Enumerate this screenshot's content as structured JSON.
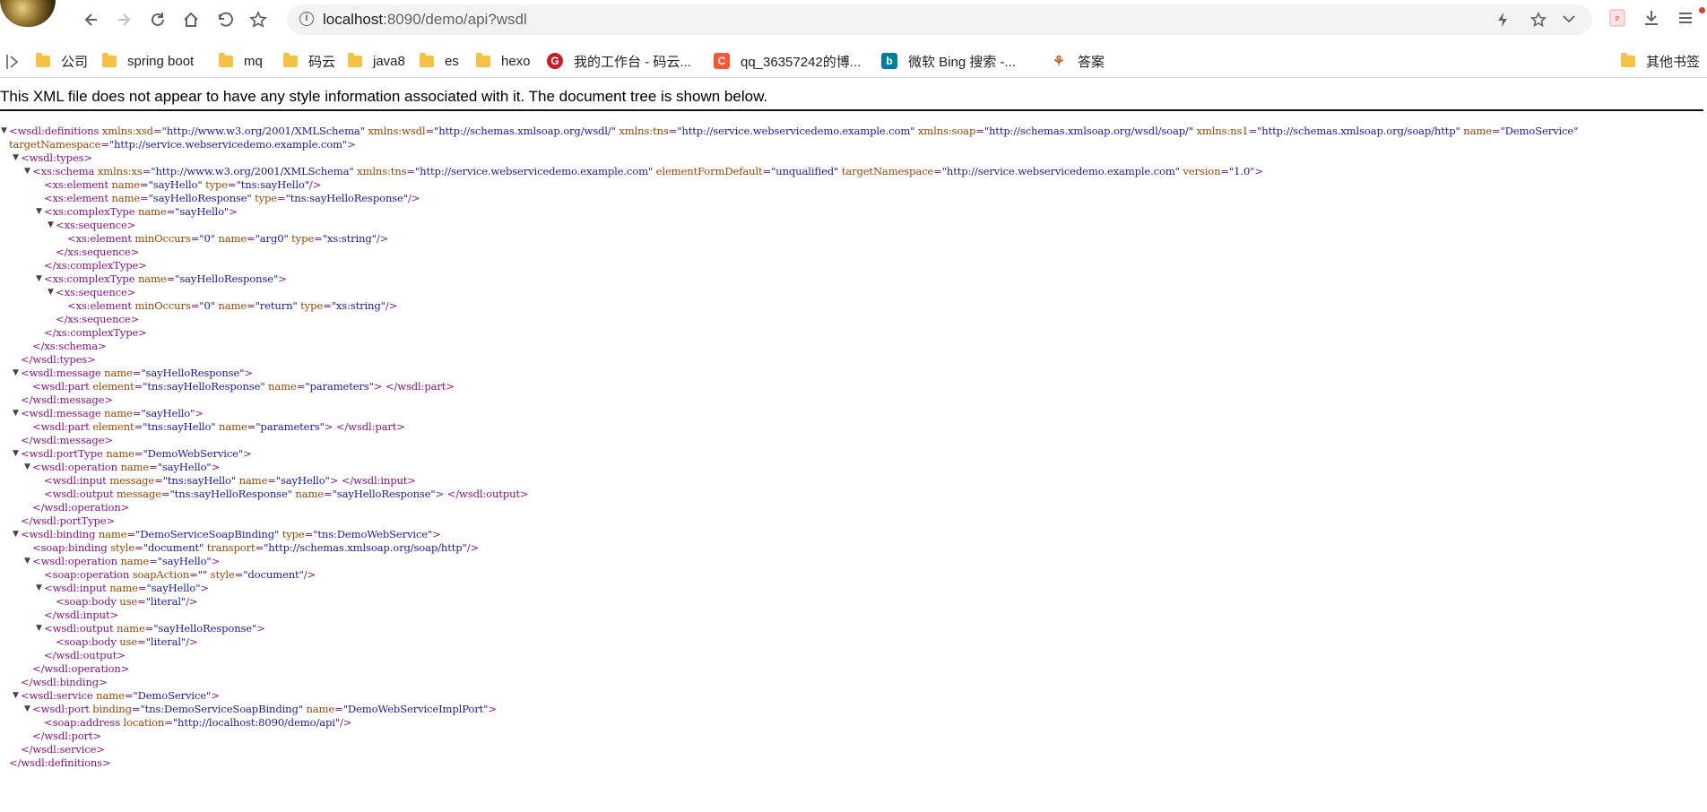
{
  "toolbar": {
    "url_host": "localhost",
    "url_path": ":8090/demo/api?wsdl",
    "icons": [
      "back-icon",
      "forward-icon",
      "reload-icon",
      "home-icon",
      "undo-icon",
      "star-icon",
      "info-icon",
      "lightning-icon",
      "bookmark-star-icon",
      "chevron-down-icon",
      "pdf-icon",
      "download-icon",
      "menu-icon"
    ]
  },
  "bookmarks": [
    {
      "label": "公司",
      "icon": "folder"
    },
    {
      "label": "spring boot",
      "icon": "folder"
    },
    {
      "label": "mq",
      "icon": "folder"
    },
    {
      "label": "码云",
      "icon": "folder"
    },
    {
      "label": "java8",
      "icon": "folder"
    },
    {
      "label": "es",
      "icon": "folder"
    },
    {
      "label": "hexo",
      "icon": "folder"
    },
    {
      "label": "我的工作台 - 码云...",
      "icon": "gitee",
      "color": "#c71d23"
    },
    {
      "label": "qq_36357242的博...",
      "icon": "csdn",
      "color": "#fc5531"
    },
    {
      "label": "微软 Bing 搜索 -...",
      "icon": "bing",
      "color": "#00809d"
    },
    {
      "label": "答案",
      "icon": "deer"
    },
    {
      "label": "其他书签",
      "icon": "folder"
    }
  ],
  "notice": "This XML file does not appear to have any style information associated with it. The document tree is shown below.",
  "colors": {
    "tag": "#881280",
    "attr_name": "#994500",
    "attr_value": "#1a1aa6"
  },
  "xml_lines": [
    {
      "d": 0,
      "t": 1,
      "p": [
        [
          "<wsdl:definitions",
          0
        ],
        [
          " xmlns:xsd",
          1
        ],
        [
          "=",
          0
        ],
        [
          "\"http://www.w3.org/2001/XMLSchema\"",
          2
        ],
        [
          " xmlns:wsdl",
          1
        ],
        [
          "=",
          0
        ],
        [
          "\"http://schemas.xmlsoap.org/wsdl/\"",
          2
        ],
        [
          " xmlns:tns",
          1
        ],
        [
          "=",
          0
        ],
        [
          "\"http://service.webservicedemo.example.com\"",
          2
        ],
        [
          " xmlns:soap",
          1
        ],
        [
          "=",
          0
        ],
        [
          "\"http://schemas.xmlsoap.org/wsdl/soap/\"",
          2
        ],
        [
          " xmlns:ns1",
          1
        ],
        [
          "=",
          0
        ],
        [
          "\"http://schemas.xmlsoap.org/soap/http\"",
          2
        ],
        [
          " name",
          1
        ],
        [
          "=",
          0
        ],
        [
          "\"DemoService\"",
          2
        ]
      ]
    },
    {
      "d": 0,
      "t": 0,
      "p": [
        [
          "targetNamespace",
          1
        ],
        [
          "=",
          0
        ],
        [
          "\"http://service.webservicedemo.example.com\"",
          2
        ],
        [
          ">",
          0
        ]
      ]
    },
    {
      "d": 1,
      "t": 1,
      "p": [
        [
          "<wsdl:types>",
          0
        ]
      ]
    },
    {
      "d": 2,
      "t": 1,
      "p": [
        [
          "<xs:schema",
          0
        ],
        [
          " xmlns:xs",
          1
        ],
        [
          "=",
          0
        ],
        [
          "\"http://www.w3.org/2001/XMLSchema\"",
          2
        ],
        [
          " xmlns:tns",
          1
        ],
        [
          "=",
          0
        ],
        [
          "\"http://service.webservicedemo.example.com\"",
          2
        ],
        [
          " elementFormDefault",
          1
        ],
        [
          "=",
          0
        ],
        [
          "\"unqualified\"",
          2
        ],
        [
          " targetNamespace",
          1
        ],
        [
          "=",
          0
        ],
        [
          "\"http://service.webservicedemo.example.com\"",
          2
        ],
        [
          " version",
          1
        ],
        [
          "=",
          0
        ],
        [
          "\"1.0\"",
          2
        ],
        [
          ">",
          0
        ]
      ]
    },
    {
      "d": 3,
      "t": 0,
      "p": [
        [
          "<xs:element",
          0
        ],
        [
          " name",
          1
        ],
        [
          "=",
          0
        ],
        [
          "\"sayHello\"",
          2
        ],
        [
          " type",
          1
        ],
        [
          "=",
          0
        ],
        [
          "\"tns:sayHello\"",
          2
        ],
        [
          "/>",
          0
        ]
      ]
    },
    {
      "d": 3,
      "t": 0,
      "p": [
        [
          "<xs:element",
          0
        ],
        [
          " name",
          1
        ],
        [
          "=",
          0
        ],
        [
          "\"sayHelloResponse\"",
          2
        ],
        [
          " type",
          1
        ],
        [
          "=",
          0
        ],
        [
          "\"tns:sayHelloResponse\"",
          2
        ],
        [
          "/>",
          0
        ]
      ]
    },
    {
      "d": 3,
      "t": 1,
      "p": [
        [
          "<xs:complexType",
          0
        ],
        [
          " name",
          1
        ],
        [
          "=",
          0
        ],
        [
          "\"sayHello\"",
          2
        ],
        [
          ">",
          0
        ]
      ]
    },
    {
      "d": 4,
      "t": 1,
      "p": [
        [
          "<xs:sequence>",
          0
        ]
      ]
    },
    {
      "d": 5,
      "t": 0,
      "p": [
        [
          "<xs:element",
          0
        ],
        [
          " minOccurs",
          1
        ],
        [
          "=",
          0
        ],
        [
          "\"0\"",
          2
        ],
        [
          " name",
          1
        ],
        [
          "=",
          0
        ],
        [
          "\"arg0\"",
          2
        ],
        [
          " type",
          1
        ],
        [
          "=",
          0
        ],
        [
          "\"xs:string\"",
          2
        ],
        [
          "/>",
          0
        ]
      ]
    },
    {
      "d": 4,
      "t": 0,
      "p": [
        [
          "</xs:sequence>",
          0
        ]
      ]
    },
    {
      "d": 3,
      "t": 0,
      "p": [
        [
          "</xs:complexType>",
          0
        ]
      ]
    },
    {
      "d": 3,
      "t": 1,
      "p": [
        [
          "<xs:complexType",
          0
        ],
        [
          " name",
          1
        ],
        [
          "=",
          0
        ],
        [
          "\"sayHelloResponse\"",
          2
        ],
        [
          ">",
          0
        ]
      ]
    },
    {
      "d": 4,
      "t": 1,
      "p": [
        [
          "<xs:sequence>",
          0
        ]
      ]
    },
    {
      "d": 5,
      "t": 0,
      "p": [
        [
          "<xs:element",
          0
        ],
        [
          " minOccurs",
          1
        ],
        [
          "=",
          0
        ],
        [
          "\"0\"",
          2
        ],
        [
          " name",
          1
        ],
        [
          "=",
          0
        ],
        [
          "\"return\"",
          2
        ],
        [
          " type",
          1
        ],
        [
          "=",
          0
        ],
        [
          "\"xs:string\"",
          2
        ],
        [
          "/>",
          0
        ]
      ]
    },
    {
      "d": 4,
      "t": 0,
      "p": [
        [
          "</xs:sequence>",
          0
        ]
      ]
    },
    {
      "d": 3,
      "t": 0,
      "p": [
        [
          "</xs:complexType>",
          0
        ]
      ]
    },
    {
      "d": 2,
      "t": 0,
      "p": [
        [
          "</xs:schema>",
          0
        ]
      ]
    },
    {
      "d": 1,
      "t": 0,
      "p": [
        [
          "</wsdl:types>",
          0
        ]
      ]
    },
    {
      "d": 1,
      "t": 1,
      "p": [
        [
          "<wsdl:message",
          0
        ],
        [
          " name",
          1
        ],
        [
          "=",
          0
        ],
        [
          "\"sayHelloResponse\"",
          2
        ],
        [
          ">",
          0
        ]
      ]
    },
    {
      "d": 2,
      "t": 0,
      "p": [
        [
          "<wsdl:part",
          0
        ],
        [
          " element",
          1
        ],
        [
          "=",
          0
        ],
        [
          "\"tns:sayHelloResponse\"",
          2
        ],
        [
          " name",
          1
        ],
        [
          "=",
          0
        ],
        [
          "\"parameters\"",
          2
        ],
        [
          "> </wsdl:part>",
          0
        ]
      ]
    },
    {
      "d": 1,
      "t": 0,
      "p": [
        [
          "</wsdl:message>",
          0
        ]
      ]
    },
    {
      "d": 1,
      "t": 1,
      "p": [
        [
          "<wsdl:message",
          0
        ],
        [
          " name",
          1
        ],
        [
          "=",
          0
        ],
        [
          "\"sayHello\"",
          2
        ],
        [
          ">",
          0
        ]
      ]
    },
    {
      "d": 2,
      "t": 0,
      "p": [
        [
          "<wsdl:part",
          0
        ],
        [
          " element",
          1
        ],
        [
          "=",
          0
        ],
        [
          "\"tns:sayHello\"",
          2
        ],
        [
          " name",
          1
        ],
        [
          "=",
          0
        ],
        [
          "\"parameters\"",
          2
        ],
        [
          "> </wsdl:part>",
          0
        ]
      ]
    },
    {
      "d": 1,
      "t": 0,
      "p": [
        [
          "</wsdl:message>",
          0
        ]
      ]
    },
    {
      "d": 1,
      "t": 1,
      "p": [
        [
          "<wsdl:portType",
          0
        ],
        [
          " name",
          1
        ],
        [
          "=",
          0
        ],
        [
          "\"DemoWebService\"",
          2
        ],
        [
          ">",
          0
        ]
      ]
    },
    {
      "d": 2,
      "t": 1,
      "p": [
        [
          "<wsdl:operation",
          0
        ],
        [
          " name",
          1
        ],
        [
          "=",
          0
        ],
        [
          "\"sayHello\"",
          2
        ],
        [
          ">",
          0
        ]
      ]
    },
    {
      "d": 3,
      "t": 0,
      "p": [
        [
          "<wsdl:input",
          0
        ],
        [
          " message",
          1
        ],
        [
          "=",
          0
        ],
        [
          "\"tns:sayHello\"",
          2
        ],
        [
          " name",
          1
        ],
        [
          "=",
          0
        ],
        [
          "\"sayHello\"",
          2
        ],
        [
          "> </wsdl:input>",
          0
        ]
      ]
    },
    {
      "d": 3,
      "t": 0,
      "p": [
        [
          "<wsdl:output",
          0
        ],
        [
          " message",
          1
        ],
        [
          "=",
          0
        ],
        [
          "\"tns:sayHelloResponse\"",
          2
        ],
        [
          " name",
          1
        ],
        [
          "=",
          0
        ],
        [
          "\"sayHelloResponse\"",
          2
        ],
        [
          "> </wsdl:output>",
          0
        ]
      ]
    },
    {
      "d": 2,
      "t": 0,
      "p": [
        [
          "</wsdl:operation>",
          0
        ]
      ]
    },
    {
      "d": 1,
      "t": 0,
      "p": [
        [
          "</wsdl:portType>",
          0
        ]
      ]
    },
    {
      "d": 1,
      "t": 1,
      "p": [
        [
          "<wsdl:binding",
          0
        ],
        [
          " name",
          1
        ],
        [
          "=",
          0
        ],
        [
          "\"DemoServiceSoapBinding\"",
          2
        ],
        [
          " type",
          1
        ],
        [
          "=",
          0
        ],
        [
          "\"tns:DemoWebService\"",
          2
        ],
        [
          ">",
          0
        ]
      ]
    },
    {
      "d": 2,
      "t": 0,
      "p": [
        [
          "<soap:binding",
          0
        ],
        [
          " style",
          1
        ],
        [
          "=",
          0
        ],
        [
          "\"document\"",
          2
        ],
        [
          " transport",
          1
        ],
        [
          "=",
          0
        ],
        [
          "\"http://schemas.xmlsoap.org/soap/http\"",
          2
        ],
        [
          "/>",
          0
        ]
      ]
    },
    {
      "d": 2,
      "t": 1,
      "p": [
        [
          "<wsdl:operation",
          0
        ],
        [
          " name",
          1
        ],
        [
          "=",
          0
        ],
        [
          "\"sayHello\"",
          2
        ],
        [
          ">",
          0
        ]
      ]
    },
    {
      "d": 3,
      "t": 0,
      "p": [
        [
          "<soap:operation",
          0
        ],
        [
          " soapAction",
          1
        ],
        [
          "=",
          0
        ],
        [
          "\"\"",
          2
        ],
        [
          " style",
          1
        ],
        [
          "=",
          0
        ],
        [
          "\"document\"",
          2
        ],
        [
          "/>",
          0
        ]
      ]
    },
    {
      "d": 3,
      "t": 1,
      "p": [
        [
          "<wsdl:input",
          0
        ],
        [
          " name",
          1
        ],
        [
          "=",
          0
        ],
        [
          "\"sayHello\"",
          2
        ],
        [
          ">",
          0
        ]
      ]
    },
    {
      "d": 4,
      "t": 0,
      "p": [
        [
          "<soap:body",
          0
        ],
        [
          " use",
          1
        ],
        [
          "=",
          0
        ],
        [
          "\"literal\"",
          2
        ],
        [
          "/>",
          0
        ]
      ]
    },
    {
      "d": 3,
      "t": 0,
      "p": [
        [
          "</wsdl:input>",
          0
        ]
      ]
    },
    {
      "d": 3,
      "t": 1,
      "p": [
        [
          "<wsdl:output",
          0
        ],
        [
          " name",
          1
        ],
        [
          "=",
          0
        ],
        [
          "\"sayHelloResponse\"",
          2
        ],
        [
          ">",
          0
        ]
      ]
    },
    {
      "d": 4,
      "t": 0,
      "p": [
        [
          "<soap:body",
          0
        ],
        [
          " use",
          1
        ],
        [
          "=",
          0
        ],
        [
          "\"literal\"",
          2
        ],
        [
          "/>",
          0
        ]
      ]
    },
    {
      "d": 3,
      "t": 0,
      "p": [
        [
          "</wsdl:output>",
          0
        ]
      ]
    },
    {
      "d": 2,
      "t": 0,
      "p": [
        [
          "</wsdl:operation>",
          0
        ]
      ]
    },
    {
      "d": 1,
      "t": 0,
      "p": [
        [
          "</wsdl:binding>",
          0
        ]
      ]
    },
    {
      "d": 1,
      "t": 1,
      "p": [
        [
          "<wsdl:service",
          0
        ],
        [
          " name",
          1
        ],
        [
          "=",
          0
        ],
        [
          "\"DemoService\"",
          2
        ],
        [
          ">",
          0
        ]
      ]
    },
    {
      "d": 2,
      "t": 1,
      "p": [
        [
          "<wsdl:port",
          0
        ],
        [
          " binding",
          1
        ],
        [
          "=",
          0
        ],
        [
          "\"tns:DemoServiceSoapBinding\"",
          2
        ],
        [
          " name",
          1
        ],
        [
          "=",
          0
        ],
        [
          "\"DemoWebServiceImplPort\"",
          2
        ],
        [
          ">",
          0
        ]
      ]
    },
    {
      "d": 3,
      "t": 0,
      "p": [
        [
          "<soap:address",
          0
        ],
        [
          " location",
          1
        ],
        [
          "=",
          0
        ],
        [
          "\"http://localhost:8090/demo/api\"",
          2
        ],
        [
          "/>",
          0
        ]
      ]
    },
    {
      "d": 2,
      "t": 0,
      "p": [
        [
          "</wsdl:port>",
          0
        ]
      ]
    },
    {
      "d": 1,
      "t": 0,
      "p": [
        [
          "</wsdl:service>",
          0
        ]
      ]
    },
    {
      "d": 0,
      "t": 0,
      "p": [
        [
          "</wsdl:definitions>",
          0
        ]
      ]
    }
  ]
}
